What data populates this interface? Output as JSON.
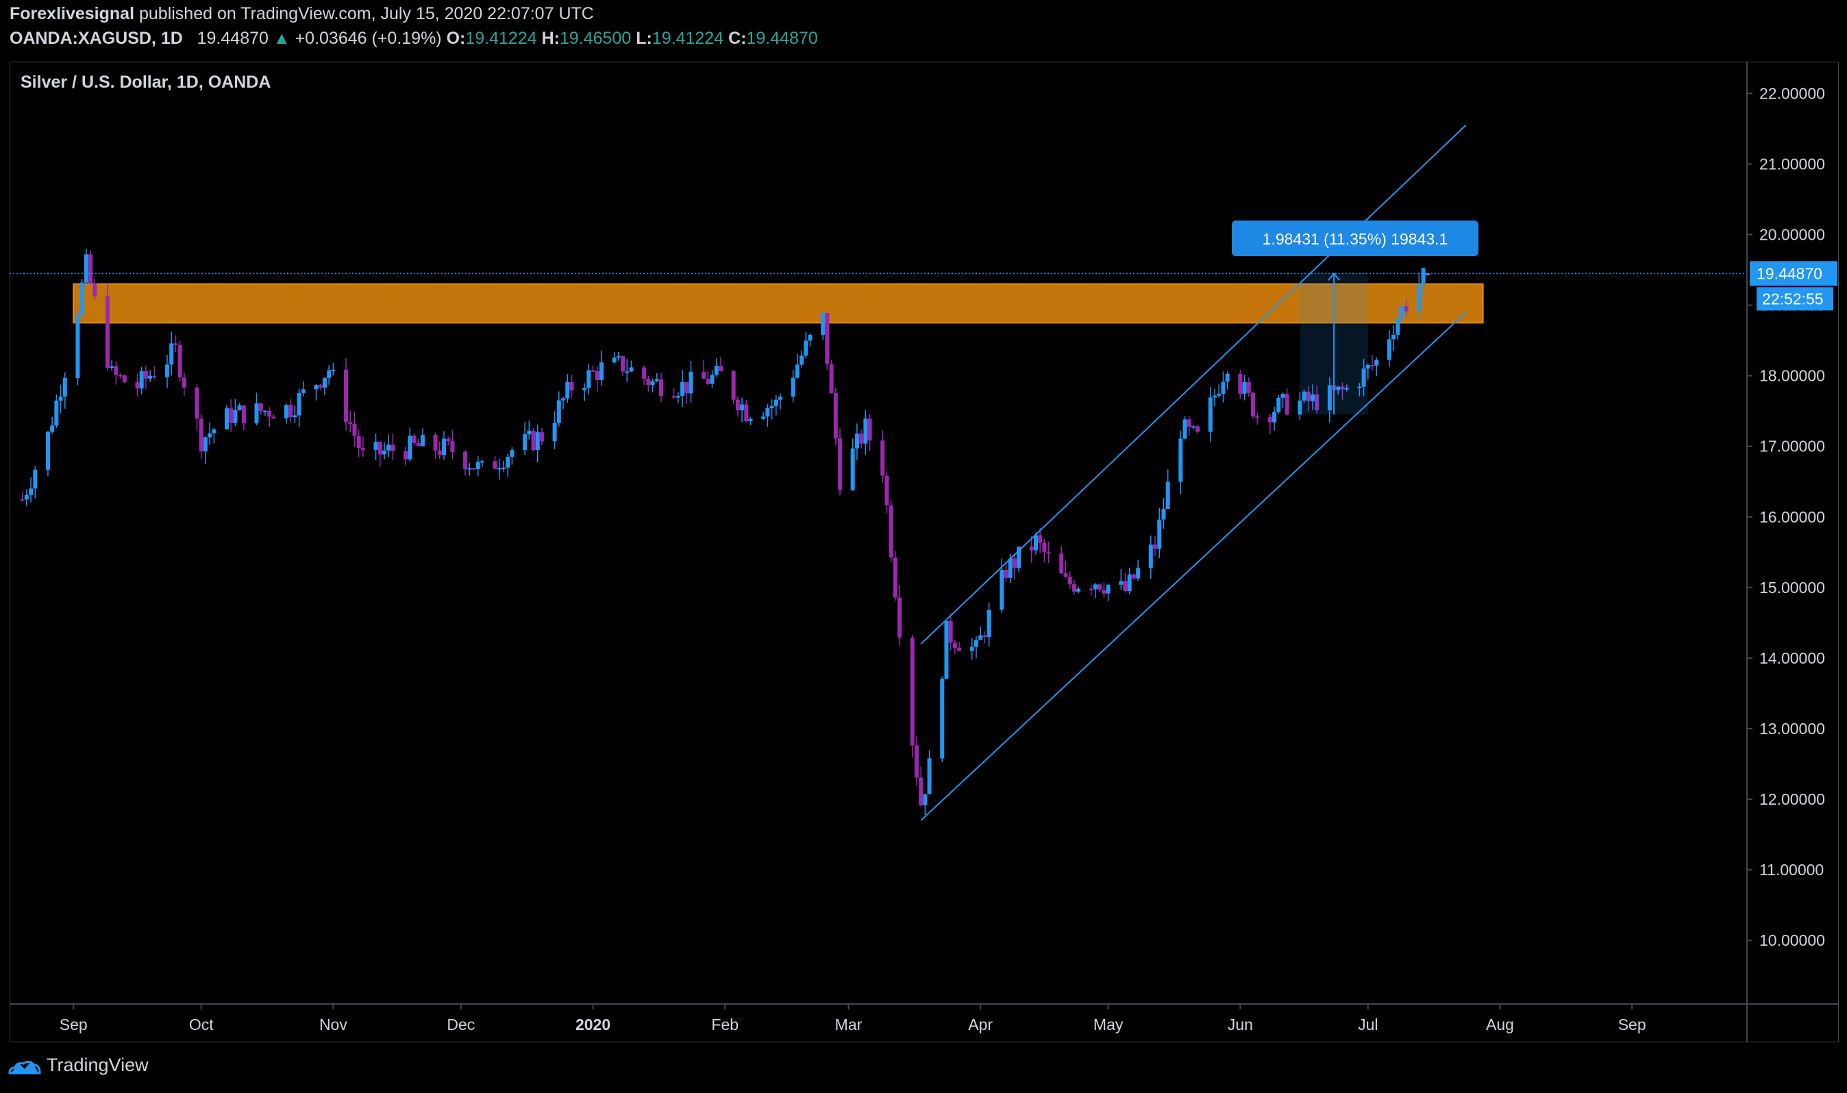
{
  "header": {
    "author": "Forexlivesignal",
    "published": " published on TradingView.com, July 15, 2020 22:07:07 UTC",
    "symbol": "OANDA:XAGUSD, 1D",
    "last": "19.44870",
    "change": "+0.03646 (+0.19%)",
    "o_label": "O:",
    "o_value": "19.41224",
    "h_label": "H:",
    "h_value": "19.46500",
    "l_label": "L:",
    "l_value": "19.41224",
    "c_label": "C:",
    "c_value": "19.44870"
  },
  "chart_title": "Silver / U.S. Dollar, 1D, OANDA",
  "footer": {
    "brand": "TradingView"
  },
  "colors": {
    "up": "#2196f3",
    "down": "#9c27b0",
    "zone": "#e88b0d",
    "channel": "#2196f3",
    "price_line": "#2196f3",
    "measure_label": "#1e88e5",
    "green": "#26a69a"
  },
  "chart_data": {
    "type": "candlestick",
    "title": "Silver / U.S. Dollar, 1D, OANDA",
    "ylim": [
      9.1,
      22.45
    ],
    "y_ticks": [
      "22.00000",
      "21.00000",
      "20.00000",
      "19.00000",
      "18.00000",
      "17.00000",
      "16.00000",
      "15.00000",
      "14.00000",
      "13.00000",
      "12.00000",
      "11.00000",
      "10.00000"
    ],
    "x_ticks": [
      "Sep",
      "Oct",
      "Nov",
      "Dec",
      "2020",
      "Feb",
      "Mar",
      "Apr",
      "May",
      "Jun",
      "Jul",
      "Aug",
      "Sep"
    ],
    "last_price_label": "19.44870",
    "countdown_label": "22:52:55",
    "measure_label": "1.98431 (11.35%) 19843.1",
    "resistance_zone": {
      "top": 19.3,
      "bottom": 18.75
    },
    "channel": {
      "upper": [
        {
          "date": "2020-03-18",
          "price": 14.2
        },
        {
          "date": "2020-07-24",
          "price": 21.55
        }
      ],
      "lower": [
        {
          "date": "2020-03-18",
          "price": 11.7
        },
        {
          "date": "2020-07-24",
          "price": 18.9
        }
      ]
    },
    "measure_box": {
      "start": "2020-06-15",
      "end": "2020-07-01",
      "low": 17.45,
      "high": 19.45
    },
    "series": [
      {
        "date": "2019-08-20",
        "close": 16.25
      },
      {
        "date": "2019-08-26",
        "close": 17.15
      },
      {
        "date": "2019-08-30",
        "close": 18.1
      },
      {
        "date": "2019-09-04",
        "close": 19.55
      },
      {
        "date": "2019-09-10",
        "close": 18.0
      },
      {
        "date": "2019-09-16",
        "close": 17.85
      },
      {
        "date": "2019-09-25",
        "close": 18.35
      },
      {
        "date": "2019-10-01",
        "close": 17.1
      },
      {
        "date": "2019-10-08",
        "close": 17.45
      },
      {
        "date": "2019-10-15",
        "close": 17.5
      },
      {
        "date": "2019-10-22",
        "close": 17.55
      },
      {
        "date": "2019-10-31",
        "close": 18.1
      },
      {
        "date": "2019-11-08",
        "close": 16.85
      },
      {
        "date": "2019-11-15",
        "close": 16.95
      },
      {
        "date": "2019-11-22",
        "close": 17.0
      },
      {
        "date": "2019-11-29",
        "close": 16.95
      },
      {
        "date": "2019-12-06",
        "close": 16.65
      },
      {
        "date": "2019-12-13",
        "close": 16.95
      },
      {
        "date": "2019-12-20",
        "close": 17.15
      },
      {
        "date": "2019-12-27",
        "close": 17.85
      },
      {
        "date": "2020-01-03",
        "close": 18.1
      },
      {
        "date": "2020-01-08",
        "close": 18.15
      },
      {
        "date": "2020-01-15",
        "close": 17.9
      },
      {
        "date": "2020-01-22",
        "close": 17.85
      },
      {
        "date": "2020-01-31",
        "close": 18.0
      },
      {
        "date": "2020-02-06",
        "close": 17.5
      },
      {
        "date": "2020-02-13",
        "close": 17.6
      },
      {
        "date": "2020-02-20",
        "close": 18.4
      },
      {
        "date": "2020-02-24",
        "close": 18.8
      },
      {
        "date": "2020-02-28",
        "close": 16.55
      },
      {
        "date": "2020-03-05",
        "close": 17.25
      },
      {
        "date": "2020-03-09",
        "close": 16.7
      },
      {
        "date": "2020-03-12",
        "close": 15.0
      },
      {
        "date": "2020-03-16",
        "close": 12.85
      },
      {
        "date": "2020-03-18",
        "close": 11.95
      },
      {
        "date": "2020-03-20",
        "close": 12.45
      },
      {
        "date": "2020-03-24",
        "close": 14.35
      },
      {
        "date": "2020-03-31",
        "close": 14.1
      },
      {
        "date": "2020-04-07",
        "close": 15.25
      },
      {
        "date": "2020-04-14",
        "close": 15.65
      },
      {
        "date": "2020-04-21",
        "close": 15.05
      },
      {
        "date": "2020-04-28",
        "close": 15.1
      },
      {
        "date": "2020-05-05",
        "close": 14.95
      },
      {
        "date": "2020-05-12",
        "close": 15.6
      },
      {
        "date": "2020-05-18",
        "close": 17.25
      },
      {
        "date": "2020-05-22",
        "close": 17.1
      },
      {
        "date": "2020-05-29",
        "close": 18.2
      },
      {
        "date": "2020-06-05",
        "close": 17.45
      },
      {
        "date": "2020-06-12",
        "close": 17.6
      },
      {
        "date": "2020-06-19",
        "close": 17.65
      },
      {
        "date": "2020-06-26",
        "close": 17.8
      },
      {
        "date": "2020-07-03",
        "close": 18.2
      },
      {
        "date": "2020-07-08",
        "close": 18.85
      },
      {
        "date": "2020-07-13",
        "close": 19.3
      },
      {
        "date": "2020-07-15",
        "close": 19.45
      }
    ]
  }
}
